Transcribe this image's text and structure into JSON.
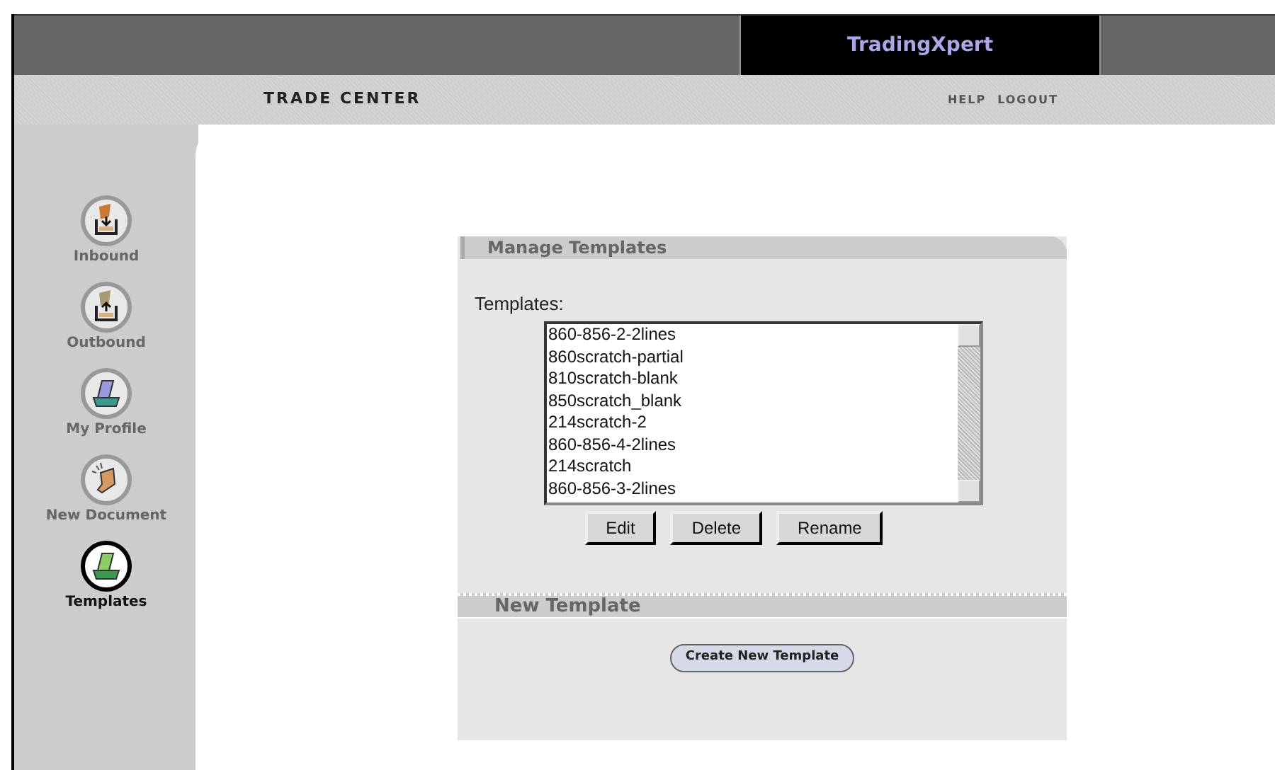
{
  "header": {
    "brand": "TradingXpert",
    "section": "TRADE CENTER",
    "links": [
      "HELP",
      "LOGOUT"
    ]
  },
  "sidebar": {
    "items": [
      {
        "label": "Inbound",
        "kind": "inbound",
        "selected": false
      },
      {
        "label": "Outbound",
        "kind": "outbound",
        "selected": false
      },
      {
        "label": "My Profile",
        "kind": "profile",
        "selected": false
      },
      {
        "label": "New Document",
        "kind": "newdoc",
        "selected": false
      },
      {
        "label": "Templates",
        "kind": "templates",
        "selected": true
      }
    ]
  },
  "manage": {
    "title": "Manage Templates",
    "list_label": "Templates:",
    "templates": [
      "860-856-2-2lines",
      "860scratch-partial",
      "810scratch-blank",
      "850scratch_blank",
      "214scratch-2",
      "860-856-4-2lines",
      "214scratch",
      "860-856-3-2lines"
    ],
    "buttons": [
      "Edit",
      "Delete",
      "Rename"
    ]
  },
  "new_template": {
    "title": "New Template",
    "button": "Create New Template"
  }
}
